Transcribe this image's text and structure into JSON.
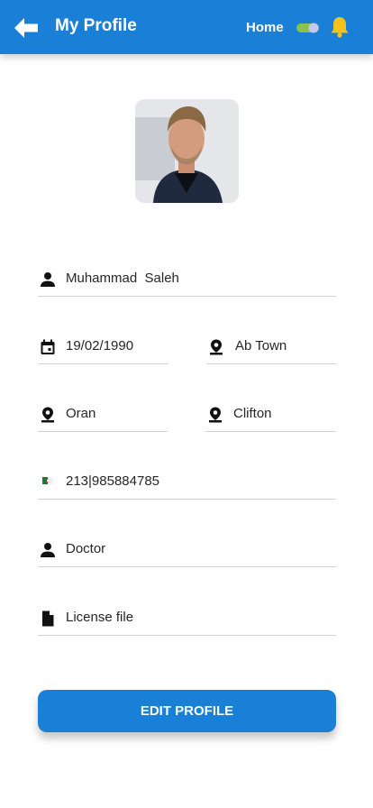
{
  "header": {
    "title": "My Profile",
    "home_label": "Home",
    "back_icon": "arrow-left-icon",
    "toggle_icon": "toggle-switch-icon",
    "bell_icon": "bell-icon",
    "background": "#1a7fd6",
    "bell_color": "#f7c21b"
  },
  "profile": {
    "name": "Muhammad  Saleh",
    "birthdate": "19/02/1990",
    "area": "Ab Town",
    "city": "Oran",
    "district": "Clifton",
    "phone": "213|985884785",
    "profession": "Doctor",
    "license": "License file"
  },
  "actions": {
    "edit_label": "EDIT PROFILE"
  }
}
